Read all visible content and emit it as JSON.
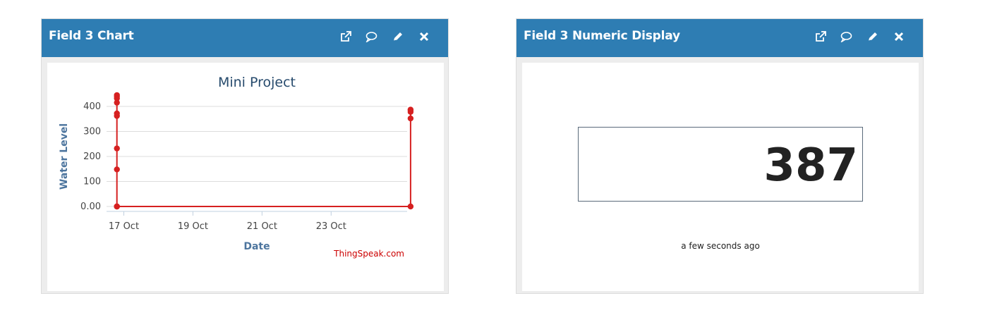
{
  "widgets": {
    "chart": {
      "title": "Field 3 Chart",
      "icons": [
        "external-link-icon",
        "comment-icon",
        "pencil-icon",
        "close-icon"
      ]
    },
    "numeric": {
      "title": "Field 3 Numeric Display",
      "value": "387",
      "updated": "a few seconds ago",
      "icons": [
        "external-link-icon",
        "comment-icon",
        "pencil-icon",
        "close-icon"
      ]
    }
  },
  "colors": {
    "header": "#2e7db3",
    "series": "#d62020",
    "credit": "#cc0000"
  },
  "chart_data": {
    "type": "line",
    "title": "Mini Project",
    "xlabel": "Date",
    "ylabel": "Water Level",
    "credit": "ThingSpeak.com",
    "y_ticks": [
      "0.00",
      "100",
      "200",
      "300",
      "400"
    ],
    "y_tick_values": [
      0,
      100,
      200,
      300,
      400
    ],
    "ylim": [
      0,
      400
    ],
    "x_ticks": [
      "17 Oct",
      "19 Oct",
      "21 Oct",
      "23 Oct"
    ],
    "x_tick_values": [
      17,
      19,
      21,
      23
    ],
    "xlim": [
      16.5,
      25.2
    ],
    "grid": true,
    "series": [
      {
        "x": [
          16.8,
          16.8,
          16.8,
          16.8,
          16.8,
          16.8,
          16.8,
          16.8,
          16.8,
          16.8,
          16.8,
          25.3,
          25.3,
          25.3,
          25.3,
          25.3
        ],
        "y": [
          0,
          0,
          0,
          148,
          232,
          362,
          372,
          415,
          432,
          440,
          445,
          0,
          352,
          378,
          385,
          387
        ]
      }
    ]
  }
}
